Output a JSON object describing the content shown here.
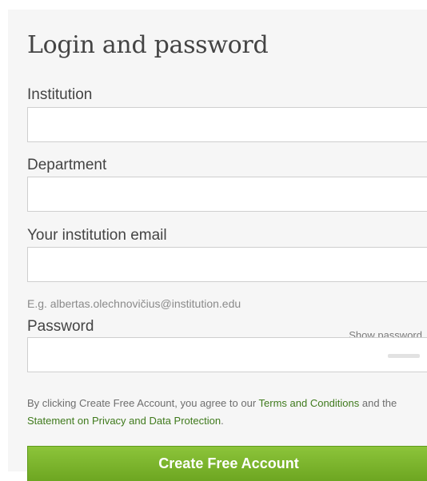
{
  "form": {
    "title": "Login and password",
    "institution": {
      "label": "Institution",
      "value": ""
    },
    "department": {
      "label": "Department",
      "value": ""
    },
    "email": {
      "label": "Your institution email",
      "value": "",
      "hint": "E.g. albertas.olechnovičius@institution.edu"
    },
    "password": {
      "label": "Password",
      "value": "",
      "show_label": "Show password"
    },
    "terms": {
      "prefix": "By clicking Create Free Account, you agree to our ",
      "terms_link": "Terms and Conditions",
      "middle": " and the ",
      "privacy_link": "Statement on Privacy and Data Protection",
      "suffix": "."
    },
    "submit_label": "Create Free Account"
  },
  "colors": {
    "link": "#3f7a1c",
    "button": "#7ab52e",
    "panel": "#f6f6f6"
  }
}
